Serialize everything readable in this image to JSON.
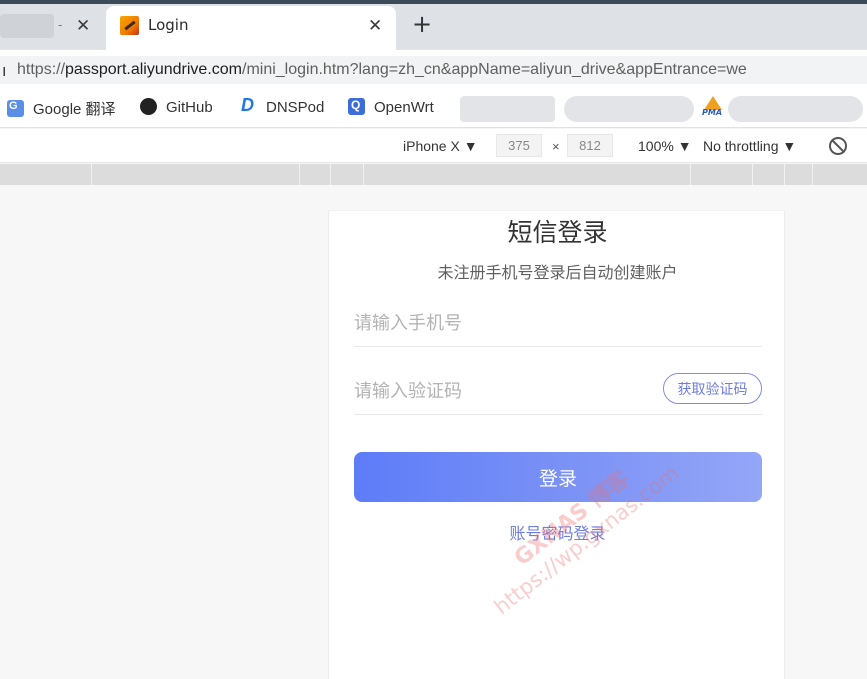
{
  "browser": {
    "active_tab": {
      "title": "Login"
    },
    "new_tab_label": "+",
    "close_glyph": "✕",
    "address": {
      "left_fragment": "ı",
      "scheme": "https://",
      "host": "passport.aliyundrive.com",
      "path": "/mini_login.htm?lang=zh_cn&appName=aliyun_drive&appEntrance=we"
    },
    "bookmarks": [
      {
        "label": "Google 翻译",
        "icon": "google-translate-icon"
      },
      {
        "label": "GitHub",
        "icon": "github-icon"
      },
      {
        "label": "DNSPod",
        "icon": "dnspod-icon"
      },
      {
        "label": "OpenWrt",
        "icon": "openwrt-icon"
      }
    ],
    "pma_label": "PMA"
  },
  "devtools": {
    "device": "iPhone X ▼",
    "width": "375",
    "height": "812",
    "separator": "×",
    "zoom": "100% ▼",
    "throttling": "No throttling ▼"
  },
  "login": {
    "title": "短信登录",
    "subtitle": "未注册手机号登录后自动创建账户",
    "phone_placeholder": "请输入手机号",
    "code_placeholder": "请输入验证码",
    "get_code_label": "获取验证码",
    "submit_label": "登录",
    "account_login_label": "账号密码登录"
  },
  "watermark": {
    "line1": "GXNAS 博客",
    "line2": "https://wp.gxnas.com"
  },
  "colors": {
    "accent": "#5d7cf7",
    "link": "#6e7ce0"
  }
}
